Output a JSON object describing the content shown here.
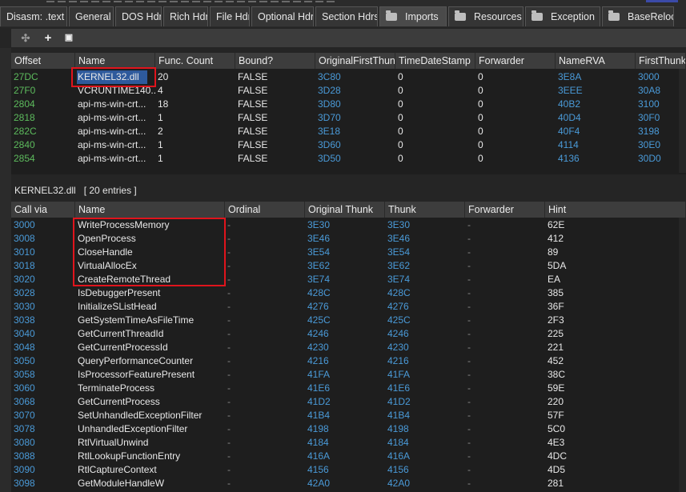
{
  "tabs": [
    {
      "label": "Disasm: .text",
      "active": false,
      "icon": null
    },
    {
      "label": "General",
      "active": false,
      "icon": null
    },
    {
      "label": "DOS Hdr",
      "active": false,
      "icon": null
    },
    {
      "label": "Rich Hdr",
      "active": false,
      "icon": null
    },
    {
      "label": "File Hdr",
      "active": false,
      "icon": null
    },
    {
      "label": "Optional Hdr",
      "active": false,
      "icon": null
    },
    {
      "label": "Section Hdrs",
      "active": false,
      "icon": null
    },
    {
      "label": "Imports",
      "active": true,
      "icon": "folder-icon"
    },
    {
      "label": "Resources",
      "active": false,
      "icon": "folder-icon"
    },
    {
      "label": "Exception",
      "active": false,
      "icon": "folder-icon"
    },
    {
      "label": "BaseReloc.",
      "active": false,
      "icon": "folder-icon"
    }
  ],
  "toolbar": {
    "buttons": [
      {
        "name": "move-icon",
        "glyph": "✣"
      },
      {
        "name": "add-icon",
        "glyph": "+"
      },
      {
        "name": "add-file-icon",
        "glyph": "▣"
      }
    ]
  },
  "imports": {
    "columns": [
      "Offset",
      "Name",
      "Func. Count",
      "Bound?",
      "OriginalFirstThun",
      "TimeDateStamp",
      "Forwarder",
      "NameRVA",
      "FirstThunk"
    ],
    "rows": [
      [
        "27DC",
        "KERNEL32.dll",
        "20",
        "FALSE",
        "3C80",
        "0",
        "0",
        "3E8A",
        "3000"
      ],
      [
        "27F0",
        "VCRUNTIME140...",
        "4",
        "FALSE",
        "3D28",
        "0",
        "0",
        "3EEE",
        "30A8"
      ],
      [
        "2804",
        "api-ms-win-crt...",
        "18",
        "FALSE",
        "3D80",
        "0",
        "0",
        "40B2",
        "3100"
      ],
      [
        "2818",
        "api-ms-win-crt...",
        "1",
        "FALSE",
        "3D70",
        "0",
        "0",
        "40D4",
        "30F0"
      ],
      [
        "282C",
        "api-ms-win-crt...",
        "2",
        "FALSE",
        "3E18",
        "0",
        "0",
        "40F4",
        "3198"
      ],
      [
        "2840",
        "api-ms-win-crt...",
        "1",
        "FALSE",
        "3D60",
        "0",
        "0",
        "4114",
        "30E0"
      ],
      [
        "2854",
        "api-ms-win-crt...",
        "1",
        "FALSE",
        "3D50",
        "0",
        "0",
        "4136",
        "30D0"
      ]
    ]
  },
  "section_label": "KERNEL32.dll   [ 20 entries ]",
  "functions": {
    "columns": [
      "Call via",
      "Name",
      "Ordinal",
      "Original Thunk",
      "Thunk",
      "Forwarder",
      "Hint"
    ],
    "rows": [
      [
        "3000",
        "WriteProcessMemory",
        "-",
        "3E30",
        "3E30",
        "-",
        "62E"
      ],
      [
        "3008",
        "OpenProcess",
        "-",
        "3E46",
        "3E46",
        "-",
        "412"
      ],
      [
        "3010",
        "CloseHandle",
        "-",
        "3E54",
        "3E54",
        "-",
        "89"
      ],
      [
        "3018",
        "VirtualAllocEx",
        "-",
        "3E62",
        "3E62",
        "-",
        "5DA"
      ],
      [
        "3020",
        "CreateRemoteThread",
        "-",
        "3E74",
        "3E74",
        "-",
        "EA"
      ],
      [
        "3028",
        "IsDebuggerPresent",
        "-",
        "428C",
        "428C",
        "-",
        "385"
      ],
      [
        "3030",
        "InitializeSListHead",
        "-",
        "4276",
        "4276",
        "-",
        "36F"
      ],
      [
        "3038",
        "GetSystemTimeAsFileTime",
        "-",
        "425C",
        "425C",
        "-",
        "2F3"
      ],
      [
        "3040",
        "GetCurrentThreadId",
        "-",
        "4246",
        "4246",
        "-",
        "225"
      ],
      [
        "3048",
        "GetCurrentProcessId",
        "-",
        "4230",
        "4230",
        "-",
        "221"
      ],
      [
        "3050",
        "QueryPerformanceCounter",
        "-",
        "4216",
        "4216",
        "-",
        "452"
      ],
      [
        "3058",
        "IsProcessorFeaturePresent",
        "-",
        "41FA",
        "41FA",
        "-",
        "38C"
      ],
      [
        "3060",
        "TerminateProcess",
        "-",
        "41E6",
        "41E6",
        "-",
        "59E"
      ],
      [
        "3068",
        "GetCurrentProcess",
        "-",
        "41D2",
        "41D2",
        "-",
        "220"
      ],
      [
        "3070",
        "SetUnhandledExceptionFilter",
        "-",
        "41B4",
        "41B4",
        "-",
        "57F"
      ],
      [
        "3078",
        "UnhandledExceptionFilter",
        "-",
        "4198",
        "4198",
        "-",
        "5C0"
      ],
      [
        "3080",
        "RtlVirtualUnwind",
        "-",
        "4184",
        "4184",
        "-",
        "4E3"
      ],
      [
        "3088",
        "RtlLookupFunctionEntry",
        "-",
        "416A",
        "416A",
        "-",
        "4DC"
      ],
      [
        "3090",
        "RtlCaptureContext",
        "-",
        "4156",
        "4156",
        "-",
        "4D5"
      ],
      [
        "3098",
        "GetModuleHandleW",
        "-",
        "42A0",
        "42A0",
        "-",
        "281"
      ]
    ]
  },
  "colors": {
    "offset": "#5dbb5d",
    "rva": "#4a9ad8",
    "dash": "#8a8a8a",
    "highlight_box": "#e0141c",
    "selection": "#2e5a9c"
  }
}
